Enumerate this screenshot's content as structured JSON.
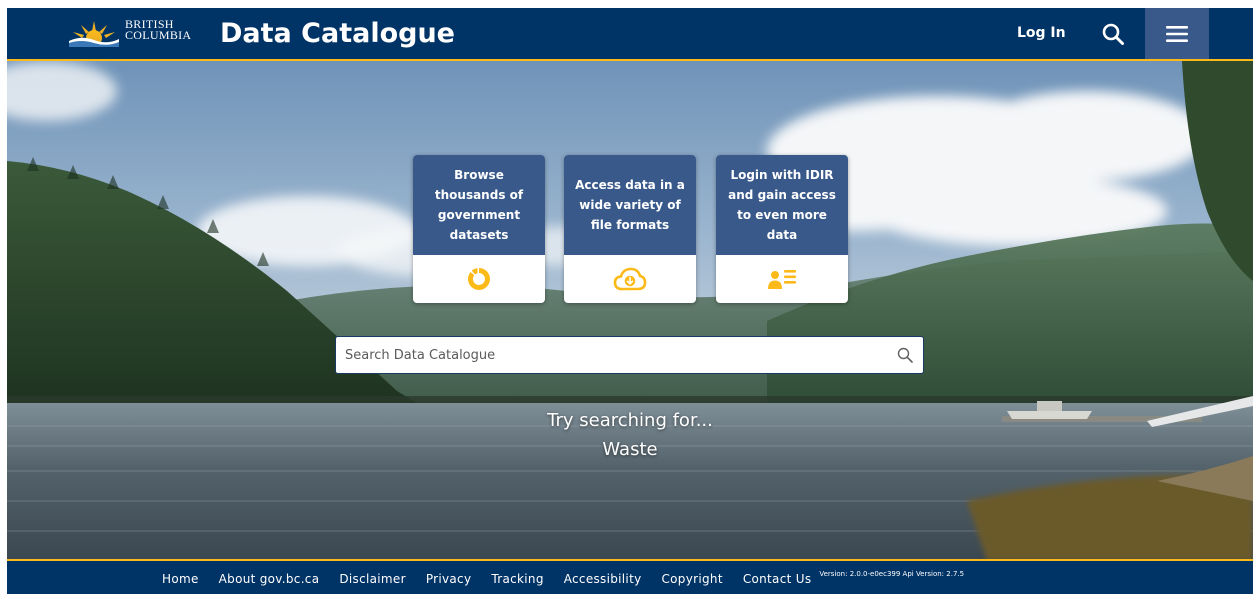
{
  "header": {
    "logo_lines": [
      "BRITISH",
      "COLUMBIA"
    ],
    "title": "Data Catalogue",
    "login_label": "Log In",
    "search_icon": "search-icon",
    "menu_icon": "hamburger-menu-icon"
  },
  "hero": {
    "cards": [
      {
        "text": "Browse thousands of government datasets",
        "icon": "donut-chart-icon"
      },
      {
        "text": "Access data in a wide variety of file formats",
        "icon": "cloud-download-icon"
      },
      {
        "text": "Login with IDIR and gain access to even more data",
        "icon": "user-list-icon"
      }
    ],
    "search": {
      "placeholder": "Search Data Catalogue",
      "value": "",
      "icon": "search-icon"
    },
    "try_label": "Try searching for...",
    "try_term": "Waste"
  },
  "footer": {
    "links": [
      "Home",
      "About gov.bc.ca",
      "Disclaimer",
      "Privacy",
      "Tracking",
      "Accessibility",
      "Copyright",
      "Contact Us"
    ],
    "version": "Version: 2.0.0-e0ec399 Api Version: 2.7.5"
  },
  "colors": {
    "header_bg": "#003366",
    "accent_gold": "#fcba19",
    "card_bg": "#38598a",
    "menu_bg": "#38598a"
  }
}
